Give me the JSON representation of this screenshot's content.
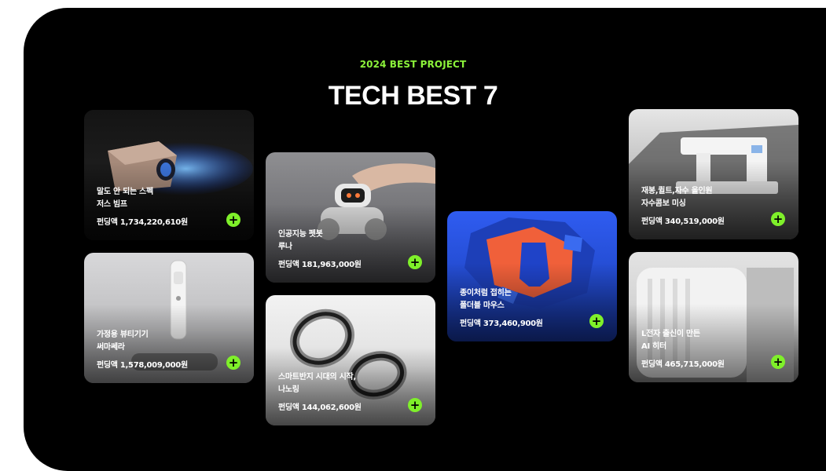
{
  "header": {
    "eyebrow": "2024 BEST PROJECT",
    "title": "TECH BEST 7"
  },
  "accent_color": "#7ff02a",
  "cards": [
    {
      "name_line1": "말도 안 되는 스펙",
      "name_line2": "저스 빔프",
      "funding": "펀딩액 1,734,220,610원",
      "image": "projector-icon"
    },
    {
      "name_line1": "가정용 뷰티기기",
      "name_line2": "써마쎄라",
      "funding": "펀딩액 1,578,009,000원",
      "image": "beauty-device-icon"
    },
    {
      "name_line1": "인공지능 펫봇",
      "name_line2": "루나",
      "funding": "펀딩액 181,963,000원",
      "image": "robot-pet-icon"
    },
    {
      "name_line1": "스마트반지 시대의 시작,",
      "name_line2": "나노링",
      "funding": "펀딩액 144,062,600원",
      "image": "smart-ring-icon"
    },
    {
      "name_line1": "종이처럼 접히는",
      "name_line2": "폴더블 마우스",
      "funding": "펀딩액 373,460,900원",
      "image": "foldable-mouse-icon"
    },
    {
      "name_line1": "재봉,퀼트,자수 올인원",
      "name_line2": "자수콤보 미싱",
      "funding": "펀딩액 340,519,000원",
      "image": "sewing-machine-icon"
    },
    {
      "name_line1": "L전자 출신이 만든",
      "name_line2": "AI 히터",
      "funding": "펀딩액 465,715,000원",
      "image": "heater-icon"
    }
  ]
}
